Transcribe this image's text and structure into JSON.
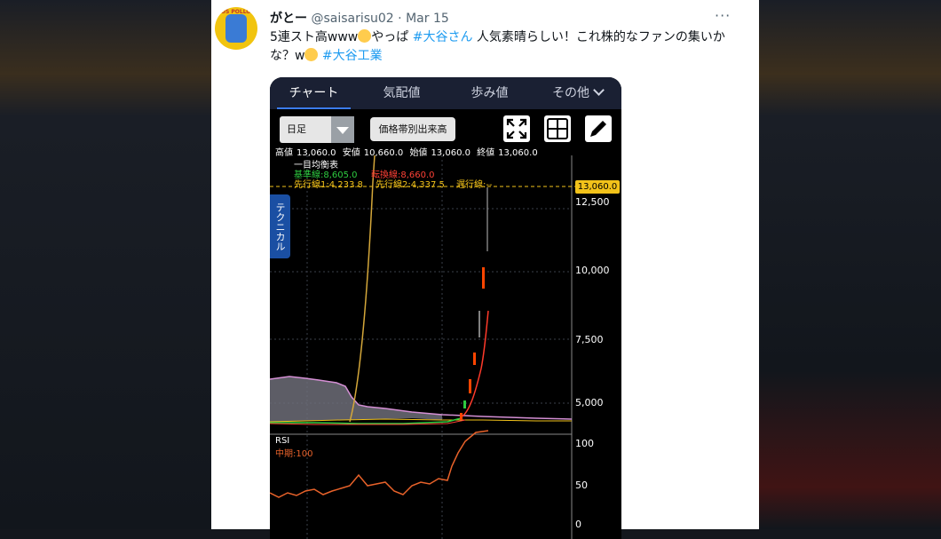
{
  "tweet": {
    "author_name": "がとー",
    "handle": "@saisarisu02",
    "separator": "·",
    "date": "Mar 15",
    "more_label": "···",
    "text_part1": "5連スト高www",
    "text_part2": "やっぱ ",
    "hashtag1": "#大谷さん",
    "text_part3": " 人気素晴らしい！これ株的なファンの集いかな？w",
    "hashtag2": "#大谷工業"
  },
  "avatar": {
    "icon": "avatar-logo-icon",
    "logo_text": "LOS POLLOS"
  },
  "app": {
    "tabs": [
      {
        "label": "チャート",
        "active": true
      },
      {
        "label": "気配値",
        "active": false
      },
      {
        "label": "歩み値",
        "active": false
      },
      {
        "label": "その他",
        "active": false
      }
    ],
    "period_select": "日足",
    "volume_button": "価格帯別出来高",
    "icons": [
      "expand-icon",
      "grid-icon",
      "pencil-icon"
    ],
    "stats": {
      "high_label": "高値",
      "high": "13,060.0",
      "low_label": "安値",
      "low": "10,660.0",
      "open_label": "始値",
      "open": "13,060.0",
      "close_label": "終値",
      "close": "13,060.0"
    },
    "side_tab": "テクニカル",
    "indicator": {
      "title": "一目均衡表",
      "kijun": "基準線:8,605.0",
      "tenkan": "転換線:8,660.0",
      "senko1": "先行線1:4,233.8",
      "senko2": "先行線2:4,337.5",
      "chikou": "遅行線:--"
    },
    "price_axis": [
      "12,500",
      "10,000",
      "7,500",
      "5,000"
    ],
    "current_price": "13,060.0",
    "rsi": {
      "title": "RSI",
      "period": "中期:100",
      "axis": [
        "100",
        "50",
        "0"
      ]
    },
    "colors": {
      "kijun": "#2ecc40",
      "tenkan": "#ff4136",
      "senko": "#f2c21a",
      "cloud": "#d48fd4",
      "candle_up": "#ff4500",
      "rsi_line": "#e8622a",
      "accent": "#3b7cf0"
    }
  }
}
